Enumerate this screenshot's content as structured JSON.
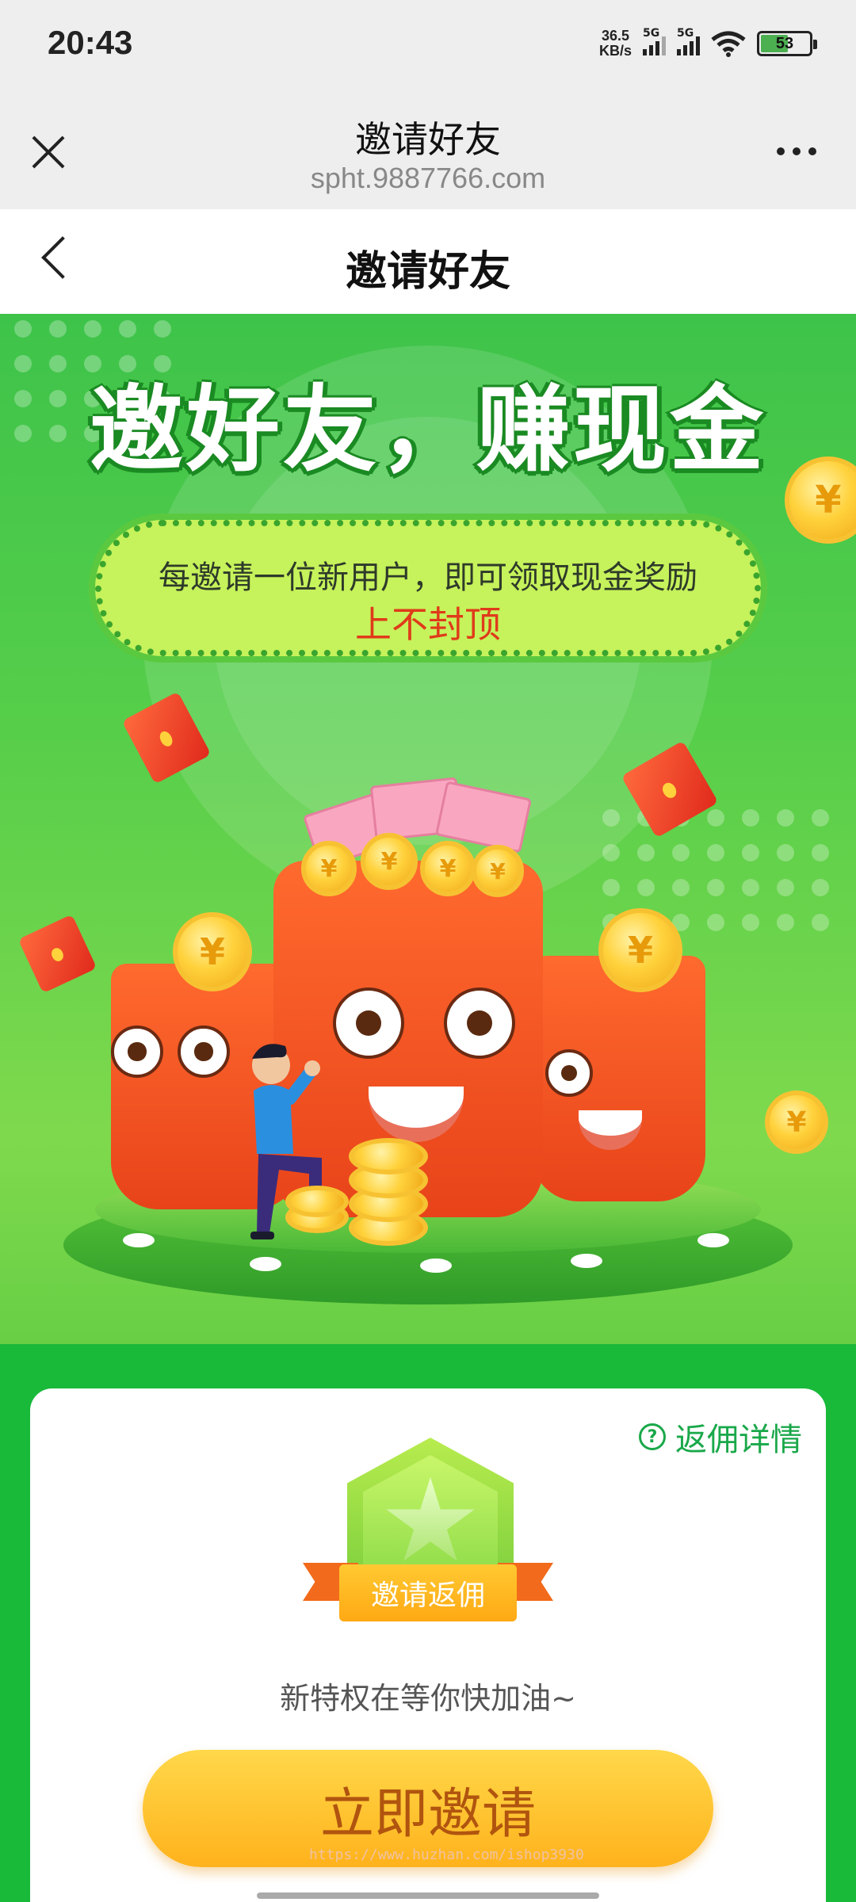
{
  "status_bar": {
    "time": "20:43",
    "net_speed_value": "36.5",
    "net_speed_unit": "KB/s",
    "sim1_label": "5G",
    "sim2_label": "5G",
    "battery": "53"
  },
  "browser_bar": {
    "title": "邀请好友",
    "url": "spht.9887766.com"
  },
  "page_header": {
    "title": "邀请好友"
  },
  "hero": {
    "headline": "邀好友，赚现金",
    "pill_line1": "每邀请一位新用户，即可领取现金奖励",
    "pill_line2": "上不封顶",
    "coin_symbol": "¥"
  },
  "card": {
    "rebate_link": "返佣详情",
    "help_icon_glyph": "?",
    "badge_label": "邀请返佣",
    "slogan": "新特权在等你快加油~",
    "invite_button": "立即邀请"
  },
  "watermark": "https://www.huzhan.com/ishop3930",
  "colors": {
    "hero_green": "#3ec34a",
    "strip_green": "#19b93a",
    "accent_orange": "#ffb21c",
    "highlight_red": "#e03a1a",
    "link_green": "#1aa84a"
  }
}
